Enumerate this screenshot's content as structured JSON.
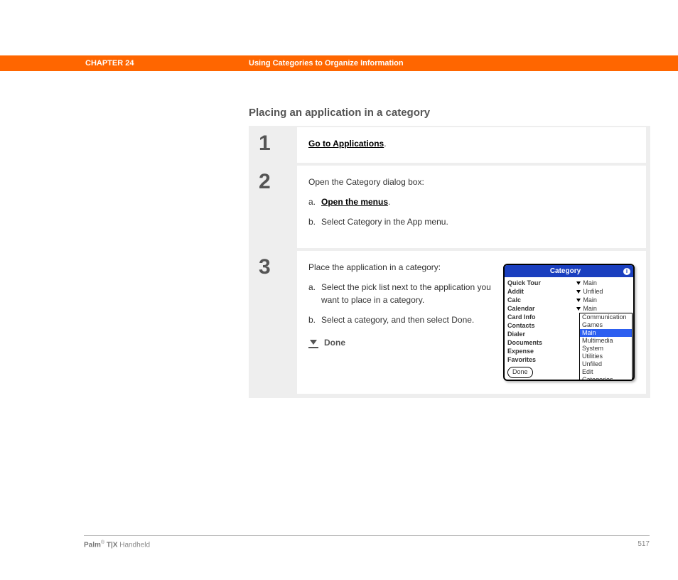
{
  "header": {
    "chapter": "CHAPTER 24",
    "subtitle": "Using Categories to Organize Information"
  },
  "page": {
    "section_title": "Placing an application in a category"
  },
  "steps": [
    {
      "num": "1",
      "link": "Go to Applications",
      "suffix": "."
    },
    {
      "num": "2",
      "intro": "Open the Category dialog box:",
      "items": [
        {
          "letter": "a.",
          "link": "Open the menus",
          "suffix": "."
        },
        {
          "letter": "b.",
          "text": "Select Category in the App menu."
        }
      ]
    },
    {
      "num": "3",
      "intro": "Place the application in a category:",
      "items": [
        {
          "letter": "a.",
          "text": "Select the pick list next to the application you want to place in a category."
        },
        {
          "letter": "b.",
          "text": "Select a category, and then select Done."
        }
      ],
      "done": "Done"
    }
  ],
  "screenshot": {
    "title": "Category",
    "info": "i",
    "apps": [
      "Quick Tour",
      "Addit",
      "Calc",
      "Calendar",
      "Card Info",
      "Contacts",
      "Dialer",
      "Documents",
      "Expense",
      "Favorites"
    ],
    "cats": [
      "Main",
      "Unfiled",
      "Main",
      "Main"
    ],
    "dropdown": [
      "Communication",
      "Games",
      "Main",
      "Multimedia",
      "System",
      "Utilities",
      "Unfiled",
      "Edit Categories..."
    ],
    "selected": "Main",
    "done_btn": "Done"
  },
  "footer": {
    "brand_bold": "Palm",
    "reg": "®",
    "brand_model": " T|X",
    "brand_suffix": " Handheld",
    "page_no": "517"
  }
}
